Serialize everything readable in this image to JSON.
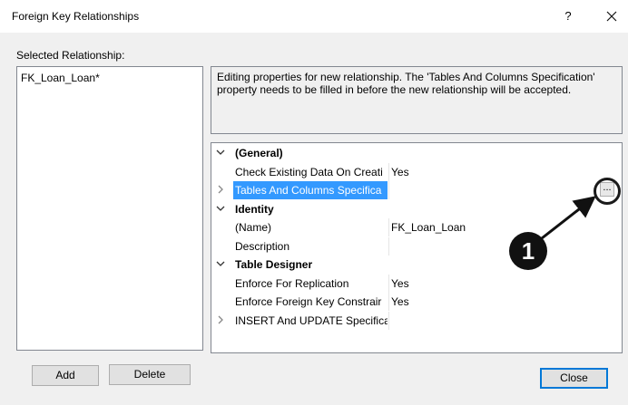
{
  "window": {
    "title": "Foreign Key Relationships",
    "help_label": "?"
  },
  "selected_relationship": {
    "label": "Selected Relationship:",
    "items": [
      "FK_Loan_Loan*"
    ]
  },
  "description": "Editing properties for new relationship.  The 'Tables And Columns Specification' property needs to be filled in before the new relationship will be accepted.",
  "properties": [
    {
      "type": "category",
      "expanded": true,
      "name": "(General)",
      "value": ""
    },
    {
      "type": "property",
      "name": "Check Existing Data On Creati",
      "value": "Yes"
    },
    {
      "type": "property",
      "expandable": true,
      "selected": true,
      "name": "Tables And Columns Specifica",
      "value": "",
      "button": "..."
    },
    {
      "type": "category",
      "expanded": true,
      "name": "Identity",
      "value": ""
    },
    {
      "type": "property",
      "name": "(Name)",
      "value": "FK_Loan_Loan"
    },
    {
      "type": "property",
      "name": "Description",
      "value": ""
    },
    {
      "type": "category",
      "expanded": true,
      "name": "Table Designer",
      "value": ""
    },
    {
      "type": "property",
      "name": "Enforce For Replication",
      "value": "Yes"
    },
    {
      "type": "property",
      "name": "Enforce Foreign Key Constrair",
      "value": "Yes"
    },
    {
      "type": "property",
      "expandable": true,
      "name": "INSERT And UPDATE Specifica",
      "value": ""
    }
  ],
  "buttons": {
    "add": "Add",
    "delete": "Delete",
    "close": "Close"
  },
  "callout": {
    "number": "1"
  },
  "colors": {
    "selection": "#3399ff",
    "accent": "#0078d7"
  }
}
